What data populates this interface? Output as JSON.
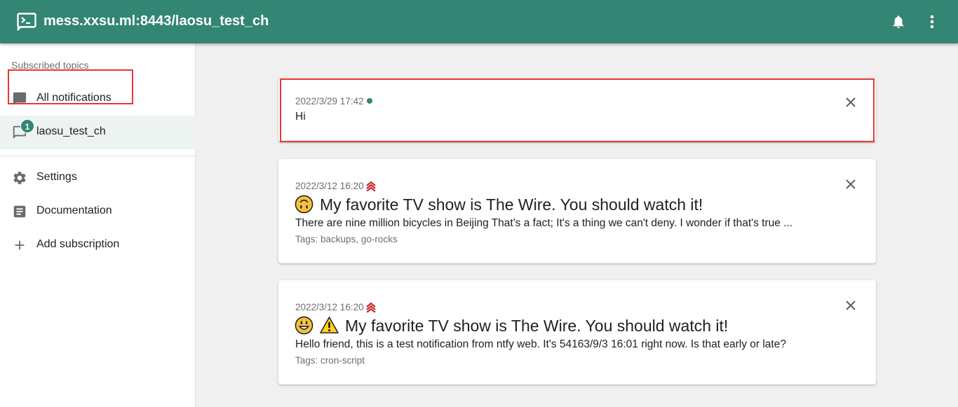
{
  "app": {
    "title": "mess.xxsu.ml:8443/laosu_test_ch",
    "logo_icon": "terminal-icon",
    "brand_color": "#338574"
  },
  "header_actions": [
    {
      "icon": "bell-icon"
    },
    {
      "icon": "more-vert-icon"
    }
  ],
  "sidebar": {
    "heading": "Subscribed topics",
    "topics": [
      {
        "label": "All notifications",
        "icon": "chat-icon",
        "selected": false
      },
      {
        "label": "laosu_test_ch",
        "icon": "chat-outline-icon",
        "selected": true,
        "badge": "1"
      }
    ],
    "menu": [
      {
        "label": "Settings",
        "icon": "gear-icon"
      },
      {
        "label": "Documentation",
        "icon": "article-icon"
      },
      {
        "label": "Add subscription",
        "icon": "plus-icon"
      }
    ]
  },
  "notifications": [
    {
      "date": "2022/3/29 17:42",
      "new": true,
      "message": "Hi"
    },
    {
      "date": "2022/3/12 16:20",
      "priority": "high",
      "emojis": [
        "upside-down-face-emoji"
      ],
      "title": "My favorite TV show is The Wire. You should watch it!",
      "message": "There are nine million bicycles in Beijing That's a fact; It's a thing we can't deny. I wonder if that's true ...",
      "tags": "Tags: backups, go-rocks"
    },
    {
      "date": "2022/3/12 16:20",
      "priority": "high",
      "emojis": [
        "grinning-face-emoji",
        "warning-emoji"
      ],
      "title": "My favorite TV show is The Wire. You should watch it!",
      "message": "Hello friend, this is a test notification from ntfy web. It's 54163/9/3 16:01 right now. Is that early or late?",
      "tags": "Tags: cron-script"
    }
  ],
  "colors": {
    "highlight": "#e53935",
    "priority_icon": "#c62828"
  }
}
